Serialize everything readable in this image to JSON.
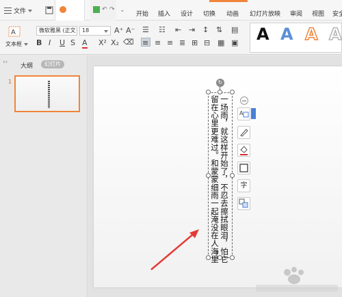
{
  "menubar": {
    "file_label": "文件",
    "tabs": [
      {
        "label": "开始"
      },
      {
        "label": "插入"
      },
      {
        "label": "设计"
      },
      {
        "label": "切换"
      },
      {
        "label": "动画"
      },
      {
        "label": "幻灯片放映"
      },
      {
        "label": "审阅"
      },
      {
        "label": "视图"
      },
      {
        "label": "安全"
      }
    ]
  },
  "ribbon": {
    "textbox_label": "文本框",
    "font_name": "微软雅黑 (正文",
    "font_size": "18",
    "wordart_letter": "A",
    "wordart_colors": [
      "#111111",
      "#5b8fd6",
      "#f0843a",
      "#c9c9c9"
    ]
  },
  "leftpanel": {
    "tab_outline": "大纲",
    "tab_slides": "幻灯片",
    "slide_number": "1"
  },
  "slide": {
    "columns": [
      "一场雨，就这样开始了，不忍去擦拭眼泪，怕它",
      "留在心里更难过。和蒙蒙细雨一起淹没在人海里",
      "。"
    ]
  },
  "float_toolbar": {
    "char_button": "字"
  },
  "colors": {
    "accent_orange": "#f0843a",
    "arrow_red": "#e53935",
    "float_flag_blue": "#4a7fd6"
  }
}
